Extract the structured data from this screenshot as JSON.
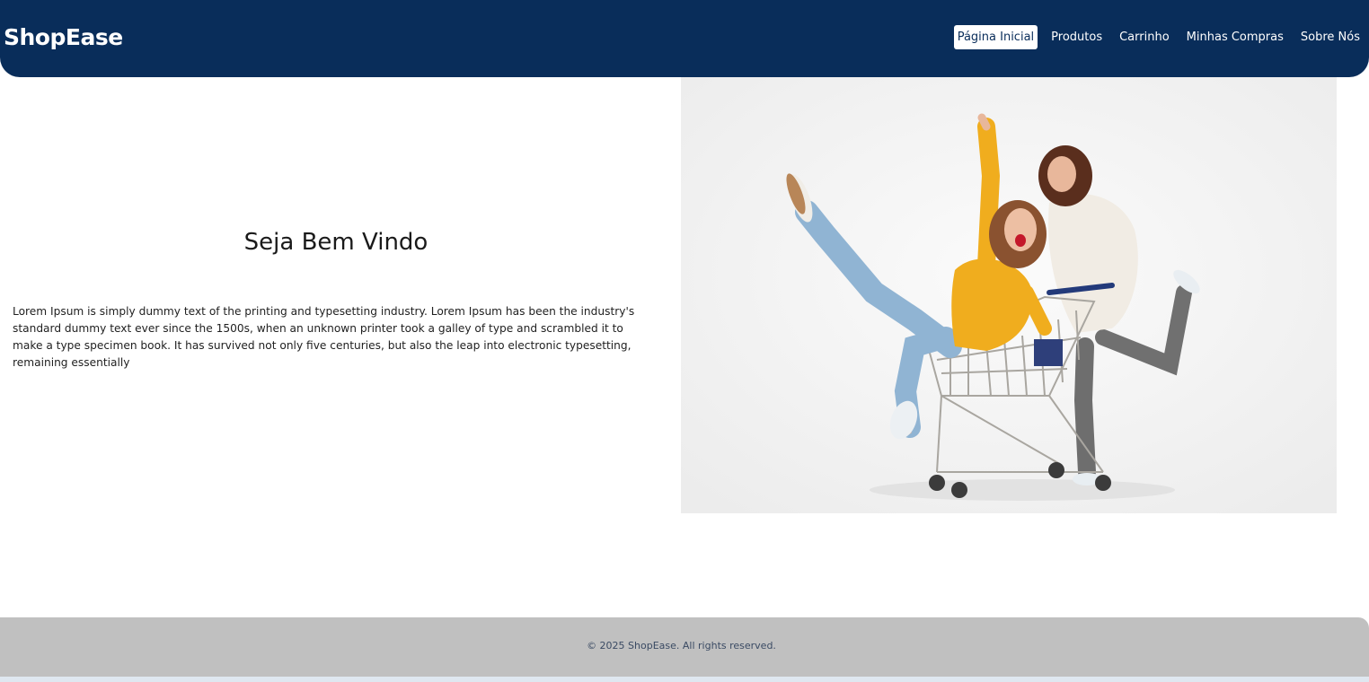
{
  "header": {
    "logo": "ShopEase",
    "nav": [
      {
        "label": "Página Inicial",
        "active": true
      },
      {
        "label": "Produtos",
        "active": false
      },
      {
        "label": "Carrinho",
        "active": false
      },
      {
        "label": "Minhas Compras",
        "active": false
      },
      {
        "label": "Sobre Nós",
        "active": false
      }
    ]
  },
  "hero": {
    "title": "Seja Bem Vindo",
    "text": "Lorem Ipsum is simply dummy text of the printing and typesetting industry. Lorem Ipsum has been the industry's standard dummy text ever since the 1500s, when an unknown printer took a galley of type and scrambled it to make a type specimen book. It has survived not only five centuries, but also the leap into electronic typesetting, remaining essentially",
    "image": "two-women-shopping-cart-photo"
  },
  "footer": {
    "copyright": "© 2025 ShopEase. All rights reserved."
  },
  "colors": {
    "header_bg": "#092d5a",
    "footer_bg": "#c0c0c0",
    "footer_text": "#3a4a63"
  }
}
